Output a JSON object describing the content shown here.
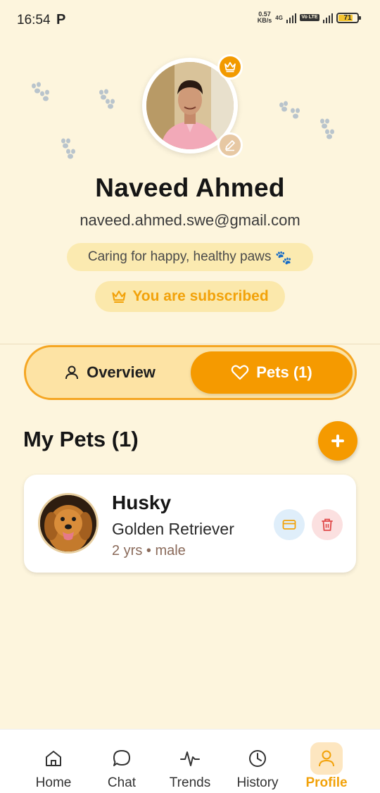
{
  "status_bar": {
    "time": "16:54",
    "carrier_icon": "P",
    "net_speed_value": "0.57",
    "net_speed_unit": "KB/s",
    "network_type": "4G",
    "volte_label": "Vo LTE",
    "battery_level": "71"
  },
  "profile": {
    "name": "Naveed Ahmed",
    "email": "naveed.ahmed.swe@gmail.com",
    "bio": "Caring for happy, healthy paws",
    "bio_emoji": "🐾",
    "subscription_label": "You are subscribed"
  },
  "tabs": {
    "overview_label": "Overview",
    "pets_label": "Pets (1)",
    "active": "pets"
  },
  "pets_section": {
    "title": "My Pets (1)",
    "add_icon": "plus-icon",
    "pets": [
      {
        "name": "Husky",
        "breed": "Golden Retriever",
        "meta": "2 yrs • male"
      }
    ]
  },
  "bottom_nav": {
    "items": [
      {
        "label": "Home",
        "icon": "home-icon"
      },
      {
        "label": "Chat",
        "icon": "chat-icon"
      },
      {
        "label": "Trends",
        "icon": "trends-icon"
      },
      {
        "label": "History",
        "icon": "history-icon"
      },
      {
        "label": "Profile",
        "icon": "profile-icon"
      }
    ],
    "active": "Profile"
  },
  "colors": {
    "background": "#fdf5dd",
    "accent": "#f59a00",
    "accent_light": "#fde3a4",
    "subscribed_text": "#f2a20a"
  }
}
